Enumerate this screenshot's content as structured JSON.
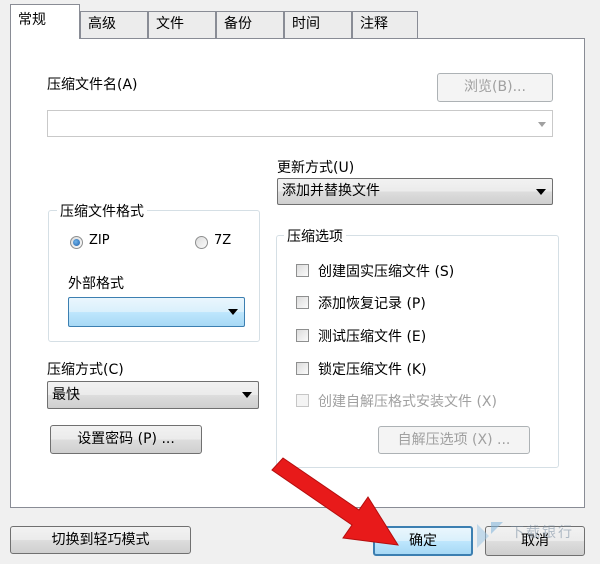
{
  "tabs": [
    {
      "label": "常规",
      "active": true
    },
    {
      "label": "高级"
    },
    {
      "label": "文件"
    },
    {
      "label": "备份"
    },
    {
      "label": "时间"
    },
    {
      "label": "注释"
    }
  ],
  "archive_name": {
    "label": "压缩文件名(A)",
    "value": "",
    "browse_label": "浏览(B)..."
  },
  "update_mode": {
    "label": "更新方式(U)",
    "value": "添加并替换文件"
  },
  "archive_format": {
    "title": "压缩文件格式",
    "zip_label": "ZIP",
    "zip_checked": true,
    "sevenz_label": "7Z",
    "sevenz_checked": false,
    "external_label": "外部格式",
    "external_value": ""
  },
  "compression_method": {
    "label": "压缩方式(C)",
    "value": "最快"
  },
  "set_password_label": "设置密码 (P) ...",
  "options": {
    "title": "压缩选项",
    "items": [
      {
        "label": "创建固实压缩文件 (S)",
        "checked": false,
        "enabled": true
      },
      {
        "label": "添加恢复记录 (P)",
        "checked": false,
        "enabled": true
      },
      {
        "label": "测试压缩文件 (E)",
        "checked": false,
        "enabled": true
      },
      {
        "label": "锁定压缩文件 (K)",
        "checked": false,
        "enabled": true
      },
      {
        "label": "创建自解压格式安装文件 (X)",
        "checked": false,
        "enabled": false
      }
    ],
    "sfx_options_label": "自解压选项 (X) ..."
  },
  "footer": {
    "switch_mode_label": "切换到轻巧模式",
    "ok_label": "确定",
    "cancel_label": "取消"
  },
  "watermark": "下载银行",
  "colors": {
    "arrow": "#e81a1a",
    "default_button_border": "#3c7fb1"
  }
}
